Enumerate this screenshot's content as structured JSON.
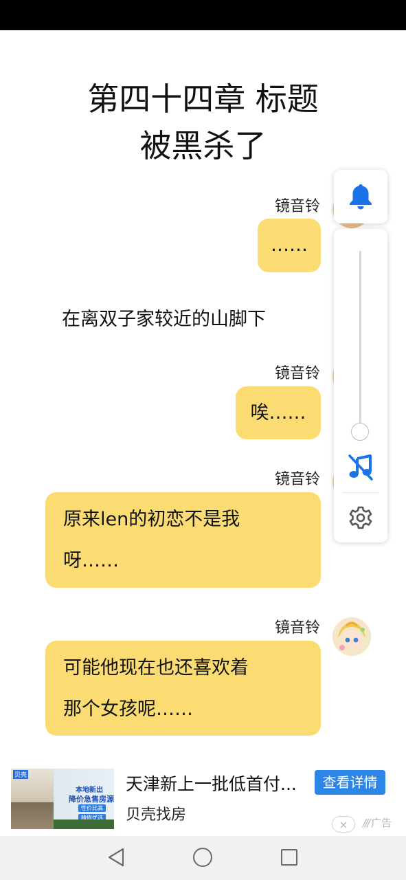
{
  "chapter": {
    "title_line1": "第四十四章 标题",
    "title_line2": "被黑杀了"
  },
  "messages": [
    {
      "name": "镜音铃",
      "text": "……"
    },
    {
      "narration": "在离双子家较近的山脚下"
    },
    {
      "name": "镜音铃",
      "text": "唉……"
    },
    {
      "name": "镜音铃",
      "line1": "原来len的初恋不是我",
      "line2": "呀……"
    },
    {
      "name": "镜音铃",
      "line1": "可能他现在也还喜欢着",
      "line2": "那个女孩呢……"
    }
  ],
  "controls": {
    "bell_icon": "bell-icon",
    "volume_level": 0.0,
    "music_icon": "music-off-icon",
    "settings_icon": "gear-icon",
    "accent_color": "#1a73e8"
  },
  "ad": {
    "thumb_logo": "贝壳",
    "thumb_line1": "本地新出",
    "thumb_line2": "降价急售房源",
    "thumb_tag1": "性价比高",
    "thumb_tag2": "精修优选",
    "headline": "天津新上一批低首付...",
    "source": "贝壳找房",
    "cta": "查看详情",
    "close": "×",
    "mark": "广告"
  },
  "colors": {
    "bubble": "#fbdc72",
    "cta": "#2d86e6"
  }
}
